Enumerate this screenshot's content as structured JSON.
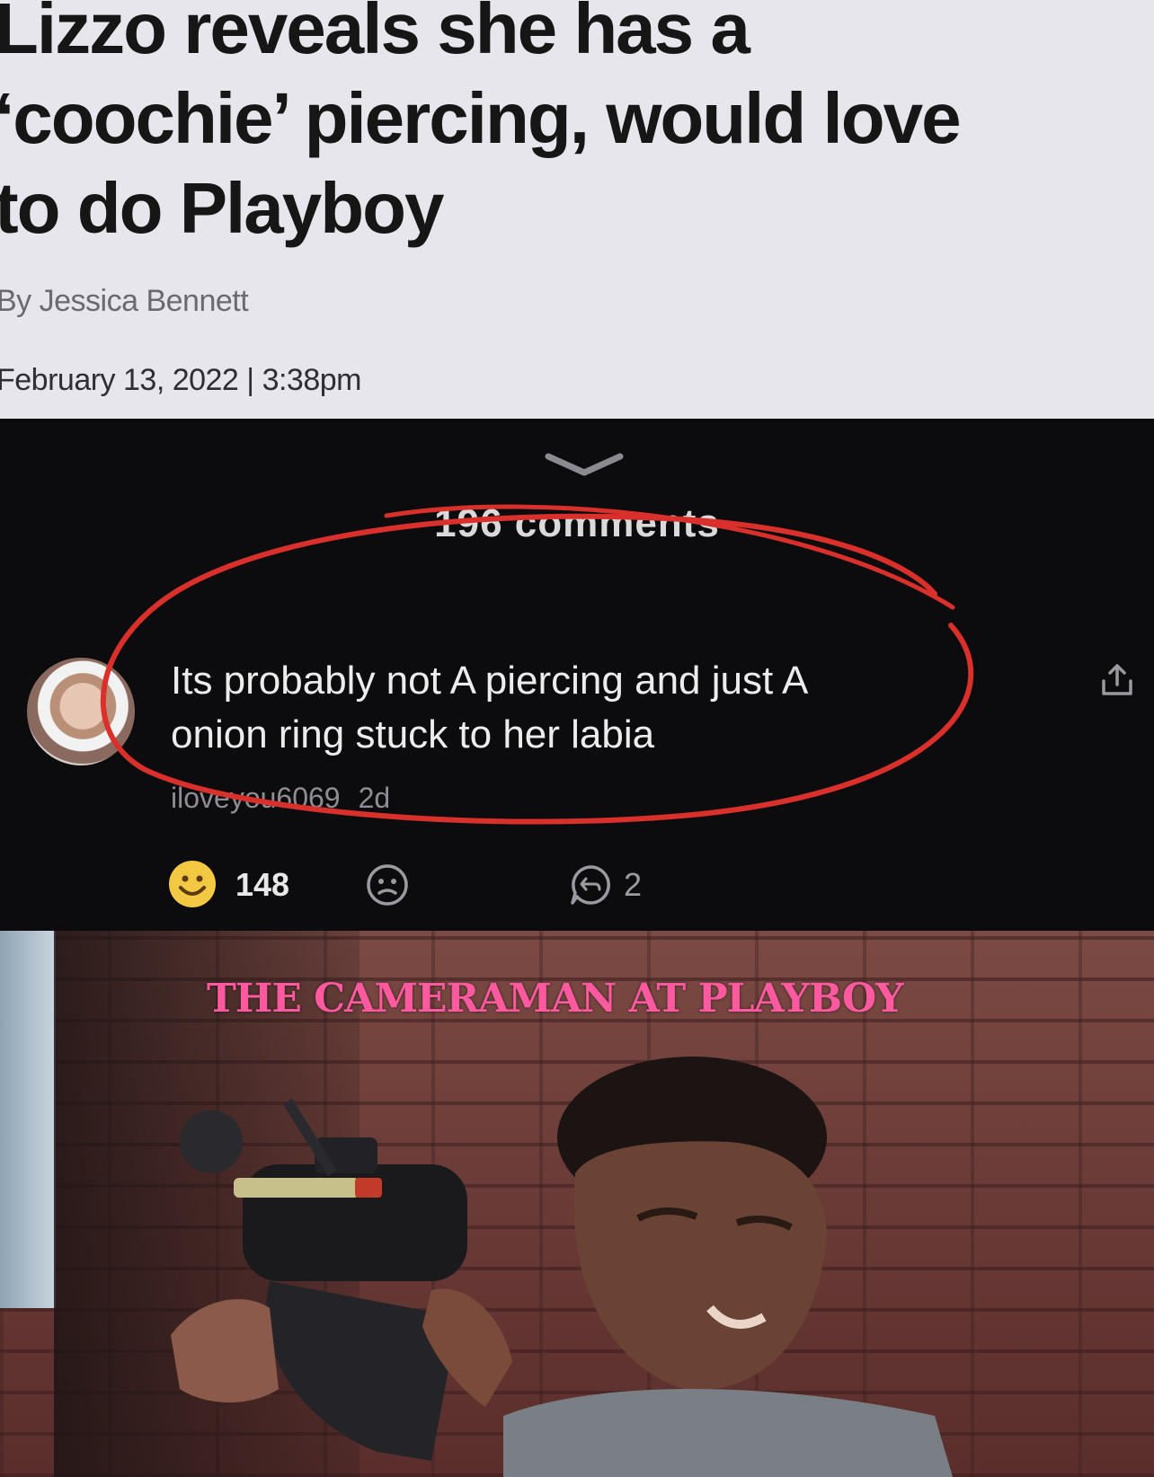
{
  "article": {
    "headline_line1": "Lizzo reveals she has a",
    "headline_line2": "‘coochie’ piercing, would love",
    "headline_line3": "to do Playboy",
    "byline_prefix": "By",
    "author": "Jessica Bennett",
    "date": "February 13, 2022 | 3:38pm"
  },
  "comments": {
    "count_label": "196 comments",
    "comment": {
      "text_line1": "Its probably not A piercing and just A",
      "text_line2": "onion ring stuck to her labia",
      "username": "iloveyou6069",
      "age": "2d",
      "like_count": "148",
      "reply_count": "2"
    },
    "icons": {
      "collapse": "chevron-down-icon",
      "share": "share-icon",
      "like": "smile-icon",
      "dislike": "sad-icon",
      "reply": "reply-icon"
    },
    "annotation_color": "#d9302b"
  },
  "photo": {
    "caption": "THE CAMERAMAN AT PLAYBOY",
    "caption_color": "#ff5aa0"
  }
}
